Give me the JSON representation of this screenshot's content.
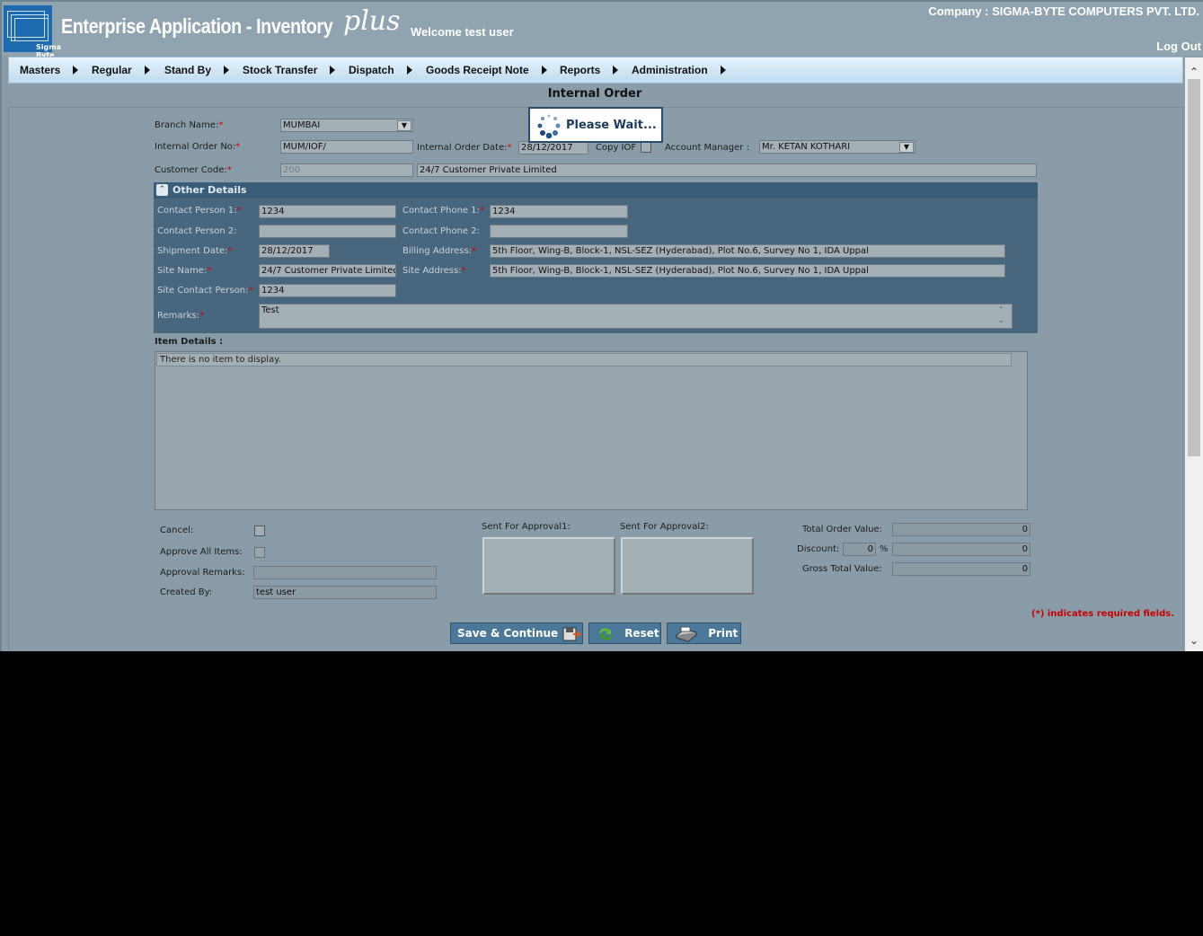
{
  "header": {
    "app_title": "Enterprise Application - Inventory",
    "app_plus": "plus",
    "logo_text": "Sigma Byte",
    "welcome": "Welcome test user",
    "company": "Company : SIGMA-BYTE COMPUTERS PVT. LTD.",
    "logout": "Log Out"
  },
  "menu": [
    "Masters",
    "Regular",
    "Stand By",
    "Stock Transfer",
    "Dispatch",
    "Goods Receipt Note",
    "Reports",
    "Administration"
  ],
  "page": {
    "title": "Internal Order"
  },
  "loading": {
    "text": "Please Wait..."
  },
  "form": {
    "branch_label": "Branch Name:",
    "branch_value": "MUMBAI",
    "io_no_label": "Internal Order No:",
    "io_no_value": "MUM/IOF/",
    "io_date_label": "Internal Order Date:",
    "io_date_value": "28/12/2017",
    "copy_iof_label": "Copy IOF",
    "account_manager_label": "Account Manager :",
    "account_manager_value": "Mr. KETAN KOTHARI",
    "customer_code_label": "Customer Code:",
    "customer_code_value": "200",
    "customer_name_value": "24/7 Customer Private Limited"
  },
  "other_details": {
    "title": "Other Details",
    "contact_person1_label": "Contact Person 1:",
    "contact_person1_value": "1234",
    "contact_phone1_label": "Contact Phone 1:",
    "contact_phone1_value": "1234",
    "contact_person2_label": "Contact Person 2:",
    "contact_person2_value": "",
    "contact_phone2_label": "Contact Phone 2:",
    "contact_phone2_value": "",
    "shipment_date_label": "Shipment Date:",
    "shipment_date_value": "28/12/2017",
    "billing_address_label": "Billing Address:",
    "billing_address_value": "5th Floor, Wing-B, Block-1, NSL-SEZ (Hyderabad), Plot No.6, Survey No 1, IDA Uppal",
    "site_name_label": "Site Name:",
    "site_name_value": "24/7 Customer Private Limited",
    "site_address_label": "Site Address:",
    "site_address_value": "5th Floor, Wing-B, Block-1, NSL-SEZ (Hyderabad), Plot No.6, Survey No 1, IDA Uppal",
    "site_contact_label": "Site Contact Person:",
    "site_contact_value": "1234",
    "remarks_label": "Remarks:",
    "remarks_value": "Test"
  },
  "items": {
    "label": "Item Details :",
    "empty_text": "There is no item to display."
  },
  "bottom": {
    "cancel_label": "Cancel:",
    "approve_all_label": "Approve All Items:",
    "approval_remarks_label": "Approval Remarks:",
    "approval_remarks_value": "",
    "created_by_label": "Created By:",
    "created_by_value": "test user",
    "sent_approval1_label": "Sent For Approval1:",
    "sent_approval2_label": "Sent For Approval2:",
    "total_order_label": "Total Order Value:",
    "total_order_value": "0",
    "discount_label": "Discount:",
    "discount_percent_value": "0",
    "discount_percent_sign": "%",
    "discount_value": "0",
    "gross_total_label": "Gross Total Value:",
    "gross_total_value": "0"
  },
  "buttons": {
    "save": "Save & Continue",
    "reset": "Reset",
    "print": "Print"
  },
  "required_note": "(*) indicates required fields.",
  "colors": {
    "header_bg": "#8fa3b0",
    "form_bg": "#8a9ca8",
    "section_bg": "#48667e",
    "button_bg": "#4b7799",
    "required": "#d40000"
  }
}
